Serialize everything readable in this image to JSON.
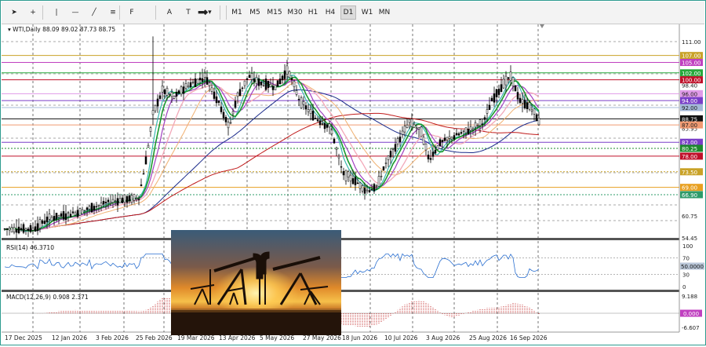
{
  "toolbar": {
    "tools": [
      {
        "name": "cursor-icon",
        "glyph": "➤"
      },
      {
        "name": "crosshair-icon",
        "glyph": "+"
      },
      {
        "name": "vertical-line-icon",
        "glyph": "|"
      },
      {
        "name": "horizontal-line-icon",
        "glyph": "—"
      },
      {
        "name": "trendline-icon",
        "glyph": "╱"
      },
      {
        "name": "channel-icon",
        "glyph": "≡"
      },
      {
        "name": "fibonacci-icon",
        "glyph": "F"
      },
      {
        "name": "text-icon",
        "glyph": "A"
      },
      {
        "name": "text-label-icon",
        "glyph": "T"
      },
      {
        "name": "rectangle-icon",
        "glyph": "▬"
      },
      {
        "name": "shapes-icon",
        "glyph": "◆▾"
      }
    ],
    "timeframes": [
      "M1",
      "M5",
      "M15",
      "M30",
      "H1",
      "H4",
      "D1",
      "W1",
      "MN"
    ],
    "active_timeframe": "D1"
  },
  "chart": {
    "symbol_line": "WTI,Daily  88.09 89.02 87.73 88.75",
    "rsi_label": "RSI(14) 46.3710",
    "macd_label": "MACD(12,26,9) 0.908 2.371",
    "price_axis_ticks": [
      "111.00",
      "98.40",
      "85.95",
      "73.50",
      "60.75",
      "54.45"
    ],
    "price_levels": [
      {
        "label": "107.00",
        "price": 107.0,
        "color": "#c9a227",
        "style": "solid"
      },
      {
        "label": "105.00",
        "price": 105.0,
        "color": "#c040c0",
        "style": "solid"
      },
      {
        "label": "102.00",
        "price": 102.0,
        "color": "#26a83b",
        "style": "solid"
      },
      {
        "label": "100.00",
        "price": 100.0,
        "color": "#c0102a",
        "style": "solid"
      },
      {
        "label": "96.00",
        "price": 96.0,
        "color": "#e09ae8",
        "style": "solid"
      },
      {
        "label": "94.00",
        "price": 94.0,
        "color": "#7a3ec8",
        "style": "solid"
      },
      {
        "label": "92.00",
        "price": 92.0,
        "color": "#a4b8d8",
        "style": "solid"
      },
      {
        "label": "88.75",
        "price": 88.75,
        "color": "#111111",
        "style": "solid"
      },
      {
        "label": "87.00",
        "price": 87.0,
        "color": "#f09a72",
        "style": "solid"
      },
      {
        "label": "82.00",
        "price": 82.0,
        "color": "#7a3ec8",
        "style": "solid"
      },
      {
        "label": "80.25",
        "price": 80.25,
        "color": "#1e8a2e",
        "style": "dotted"
      },
      {
        "label": "78.00",
        "price": 78.0,
        "color": "#c0102a",
        "style": "solid"
      },
      {
        "label": "73.50",
        "price": 73.5,
        "color": "#c9a227",
        "style": "dotted"
      },
      {
        "label": "69.00",
        "price": 69.0,
        "color": "#e8a020",
        "style": "solid"
      },
      {
        "label": "66.90",
        "price": 66.9,
        "color": "#2e9b6a",
        "style": "dotted"
      }
    ],
    "rsi_ticks": [
      "100",
      "70",
      "30",
      "0"
    ],
    "rsi_current": "50.0000",
    "macd_ticks": [
      "9.188",
      "-6.607"
    ],
    "macd_current": "0.000",
    "date_ticks": [
      "17 Dec 2025",
      "12 Jan 2026",
      "3 Feb 2026",
      "25 Feb 2026",
      "19 Mar 2026",
      "13 Apr 2026",
      "5 May 2026",
      "27 May 2026",
      "18 Jun 2026",
      "10 Jul 2026",
      "3 Aug 2026",
      "25 Aug 2026",
      "16 Sep 2026"
    ]
  },
  "colors": {
    "grid": "#555555",
    "candle": "#000000",
    "ma_fast": "#1a9a2e",
    "ma_teal": "#3bb7b0",
    "ma_purple": "#a040c0",
    "ma_pink": "#f2a8b8",
    "ma_orange": "#f0b070",
    "ma_blue": "#1a2a8a",
    "ma_red": "#c01a1a",
    "rsi_line": "#2a6fd0",
    "macd_hist": "#b80000"
  },
  "overlay": {
    "name": "oil-pumpjack-sunset-photo"
  }
}
